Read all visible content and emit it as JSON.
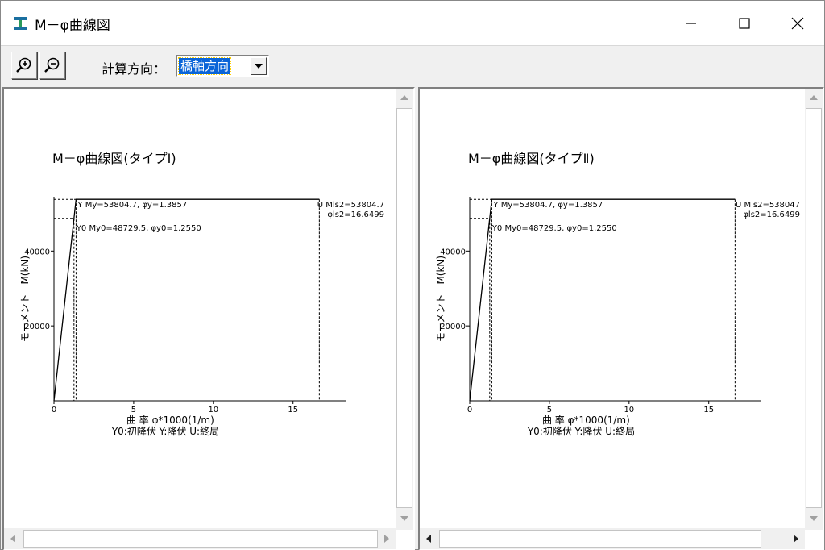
{
  "window": {
    "title": "M－φ曲線図",
    "controls": {
      "minimize": "—",
      "maximize": "☐",
      "close": "✕"
    }
  },
  "toolbar": {
    "direction_label": "計算方向：",
    "direction_value": "橋軸方向"
  },
  "charts": [
    {
      "title": "M－φ曲線図(タイプⅠ)",
      "y_label": "モーメント　M(kN)",
      "x_label": "曲 率 φ*1000(1/m)",
      "legend": "Y0:初降伏 Y:降伏 U:終局",
      "y_ticks": [
        "20000",
        "40000"
      ],
      "x_ticks": [
        "0",
        "5",
        "10",
        "15"
      ],
      "annotation_y": "Y My=53804.7, φy=1.3857",
      "annotation_y0": "Y0 My0=48729.5, φy0=1.2550",
      "annotation_u1": "U Mls2=53804.7",
      "annotation_u2": "φls2=16.6499"
    },
    {
      "title": "M－φ曲線図(タイプⅡ)",
      "y_label": "モーメント　M(kN)",
      "x_label": "曲 率 φ*1000(1/m)",
      "legend": "Y0:初降伏 Y:降伏 U:終局",
      "y_ticks": [
        "20000",
        "40000"
      ],
      "x_ticks": [
        "0",
        "5",
        "10",
        "15"
      ],
      "annotation_y": "Y My=53804.7, φy=1.3857",
      "annotation_y0": "Y0 My0=48729.5, φy0=1.2550",
      "annotation_u1": "U Mls2=538047",
      "annotation_u2": "φls2=16.6499"
    }
  ],
  "chart_data": [
    {
      "type": "line",
      "title": "M－φ曲線図(タイプⅠ)",
      "xlabel": "曲 率 φ*1000(1/m)",
      "ylabel": "モーメント　M(kN)",
      "xlim": [
        0,
        18.3
      ],
      "ylim": [
        0,
        54500
      ],
      "x": [
        0,
        1.255,
        1.3857,
        16.6499
      ],
      "y": [
        0,
        48729.5,
        53804.7,
        53804.7
      ],
      "points": {
        "Y0": [
          1.255,
          48729.5
        ],
        "Y": [
          1.3857,
          53804.7
        ],
        "U": [
          16.6499,
          53804.7
        ]
      }
    },
    {
      "type": "line",
      "title": "M－φ曲線図(タイプⅡ)",
      "xlabel": "曲 率 φ*1000(1/m)",
      "ylabel": "モーメント　M(kN)",
      "xlim": [
        0,
        18.3
      ],
      "ylim": [
        0,
        54500
      ],
      "x": [
        0,
        1.255,
        1.3857,
        16.6499
      ],
      "y": [
        0,
        48729.5,
        53804.7,
        53804.7
      ],
      "points": {
        "Y0": [
          1.255,
          48729.5
        ],
        "Y": [
          1.3857,
          53804.7
        ],
        "U": [
          16.6499,
          53804.7
        ]
      }
    }
  ]
}
